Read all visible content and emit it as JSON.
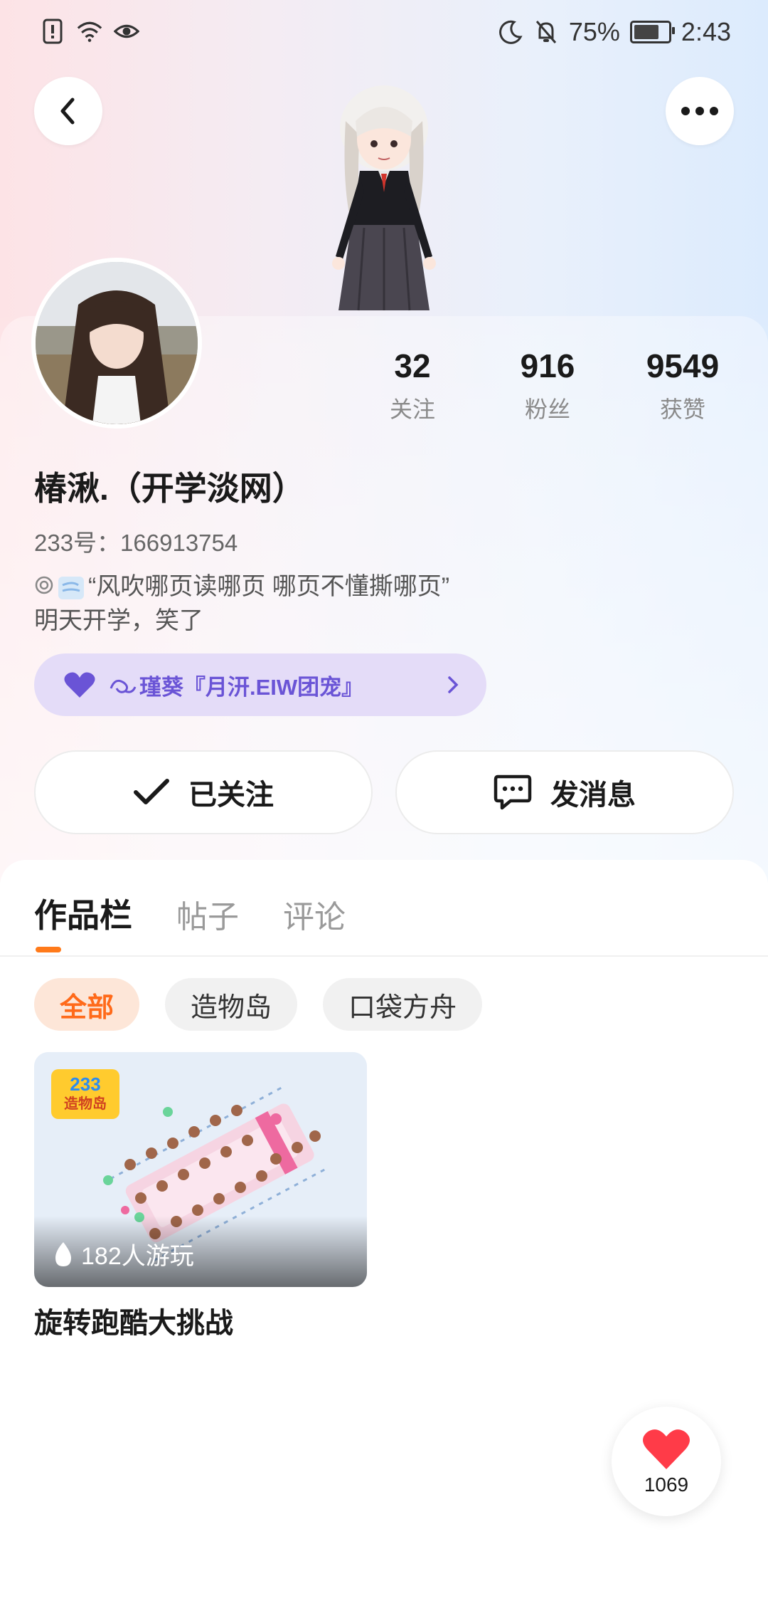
{
  "status_bar": {
    "battery": "75%",
    "time": "2:43",
    "icons": [
      "alert-sim-icon",
      "wifi-icon",
      "eye-icon",
      "moon-icon",
      "bell-off-icon",
      "battery-icon"
    ]
  },
  "header": {
    "back_icon": "back-arrow-icon",
    "more_icon": "more-dots-icon"
  },
  "profile": {
    "nickname": "椿湫.（开学淡网）",
    "uid": "233号：166913754",
    "bio_line1": "“风吹哪页读哪页  哪页不懂撕哪页”",
    "bio_line2": "明天开学，笑了",
    "stats": [
      {
        "value": "32",
        "label": "关注"
      },
      {
        "value": "916",
        "label": "粉丝"
      },
      {
        "value": "9549",
        "label": "获赞"
      }
    ],
    "guild": "瑾葵『月汧.EIW团宠』"
  },
  "actions": {
    "follow_label": "已关注",
    "message_label": "发消息"
  },
  "tabs": [
    "作品栏",
    "帖子",
    "评论"
  ],
  "filters": [
    "全部",
    "造物岛",
    "口袋方舟"
  ],
  "works": [
    {
      "title": "旋转跑酷大挑战",
      "plays": "182人游玩",
      "logo_top": "233",
      "logo_bottom": "造物岛"
    }
  ],
  "like_fab": {
    "count": "1069"
  },
  "colors": {
    "accent": "#ff7a1a",
    "guild": "#6a54d6",
    "like": "#ff3b48"
  }
}
